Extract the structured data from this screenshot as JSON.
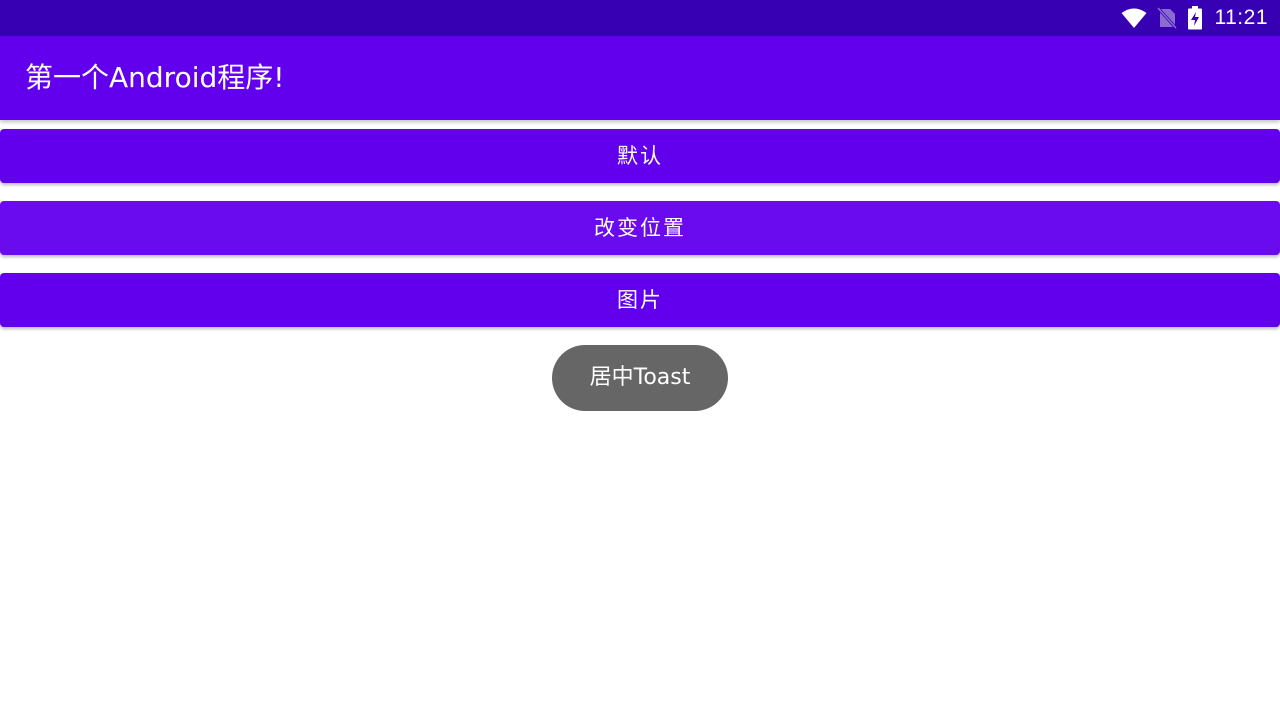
{
  "status_bar": {
    "time": "11:21",
    "icons": [
      "wifi-icon",
      "no-sim-icon",
      "battery-charging-icon"
    ]
  },
  "app_bar": {
    "title": "第一个Android程序!"
  },
  "buttons": [
    {
      "label": "默认"
    },
    {
      "label": "改变位置"
    },
    {
      "label": "图片"
    }
  ],
  "toast": {
    "text": "居中Toast"
  },
  "colors": {
    "status_bar": "#3700b3",
    "primary": "#6200ee",
    "toast_bg": "#666666"
  }
}
